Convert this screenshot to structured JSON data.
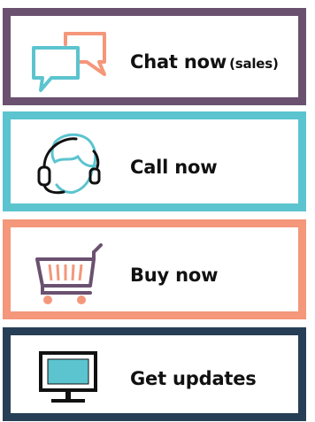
{
  "cards": [
    {
      "id": "chat",
      "label": "Chat now",
      "sub": "(sales)",
      "icon": "chat-bubbles-icon",
      "color": "#6b5170"
    },
    {
      "id": "call",
      "label": "Call now",
      "icon": "headset-agent-icon",
      "color": "#5bc4cf"
    },
    {
      "id": "buy",
      "label": "Buy now",
      "icon": "shopping-cart-icon",
      "color": "#f4977a"
    },
    {
      "id": "update",
      "label": "Get updates",
      "icon": "monitor-icon",
      "color": "#273f56"
    }
  ],
  "colors": {
    "chat_border": "#6b5170",
    "call_border": "#5bc4cf",
    "buy_border": "#f4977a",
    "update_border": "#273f56",
    "icon_teal": "#5bc4cf",
    "icon_orange": "#f4977a",
    "icon_purple": "#6b5170",
    "icon_black": "#111111"
  }
}
